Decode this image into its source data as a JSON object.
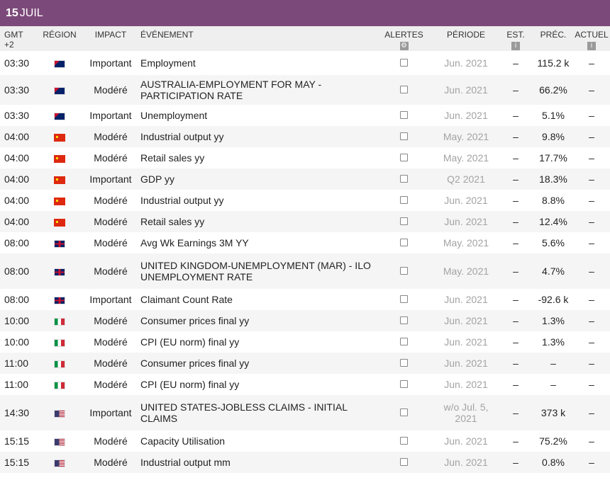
{
  "date": {
    "day": "15",
    "month": "JUIL"
  },
  "headers": {
    "gmt": "GMT +2",
    "region": "RÉGION",
    "impact": "IMPACT",
    "event": "ÉVÉNEMENT",
    "alerts": "ALERTES",
    "period": "PÉRIODE",
    "est": "EST.",
    "prec": "PRÉC.",
    "actuel": "ACTUEL"
  },
  "icons": {
    "gear": "gear-icon",
    "info": "info-icon"
  },
  "rows": [
    {
      "time": "03:30",
      "flag": "au",
      "impact": "Important",
      "event": "Employment",
      "period": "Jun. 2021",
      "est": "–",
      "prec": "115.2 k",
      "actuel": "–"
    },
    {
      "time": "03:30",
      "flag": "au",
      "impact": "Modéré",
      "event": "AUSTRALIA-EMPLOYMENT FOR MAY - PARTICIPATION RATE",
      "period": "Jun. 2021",
      "est": "–",
      "prec": "66.2%",
      "actuel": "–"
    },
    {
      "time": "03:30",
      "flag": "au",
      "impact": "Important",
      "event": "Unemployment",
      "period": "Jun. 2021",
      "est": "–",
      "prec": "5.1%",
      "actuel": "–"
    },
    {
      "time": "04:00",
      "flag": "cn",
      "impact": "Modéré",
      "event": "Industrial output yy",
      "period": "May. 2021",
      "est": "–",
      "prec": "9.8%",
      "actuel": "–"
    },
    {
      "time": "04:00",
      "flag": "cn",
      "impact": "Modéré",
      "event": "Retail sales yy",
      "period": "May. 2021",
      "est": "–",
      "prec": "17.7%",
      "actuel": "–"
    },
    {
      "time": "04:00",
      "flag": "cn",
      "impact": "Important",
      "event": "GDP yy",
      "period": "Q2 2021",
      "est": "–",
      "prec": "18.3%",
      "actuel": "–"
    },
    {
      "time": "04:00",
      "flag": "cn",
      "impact": "Modéré",
      "event": "Industrial output yy",
      "period": "Jun. 2021",
      "est": "–",
      "prec": "8.8%",
      "actuel": "–"
    },
    {
      "time": "04:00",
      "flag": "cn",
      "impact": "Modéré",
      "event": "Retail sales yy",
      "period": "Jun. 2021",
      "est": "–",
      "prec": "12.4%",
      "actuel": "–"
    },
    {
      "time": "08:00",
      "flag": "gb",
      "impact": "Modéré",
      "event": "Avg Wk Earnings 3M YY",
      "period": "May. 2021",
      "est": "–",
      "prec": "5.6%",
      "actuel": "–"
    },
    {
      "time": "08:00",
      "flag": "gb",
      "impact": "Modéré",
      "event": "UNITED KINGDOM-UNEMPLOYMENT (MAR) - ILO UNEMPLOYMENT RATE",
      "period": "May. 2021",
      "est": "–",
      "prec": "4.7%",
      "actuel": "–"
    },
    {
      "time": "08:00",
      "flag": "gb",
      "impact": "Important",
      "event": "Claimant Count Rate",
      "period": "Jun. 2021",
      "est": "–",
      "prec": "-92.6 k",
      "actuel": "–"
    },
    {
      "time": "10:00",
      "flag": "it",
      "impact": "Modéré",
      "event": "Consumer prices final yy",
      "period": "Jun. 2021",
      "est": "–",
      "prec": "1.3%",
      "actuel": "–"
    },
    {
      "time": "10:00",
      "flag": "it",
      "impact": "Modéré",
      "event": "CPI (EU norm) final yy",
      "period": "Jun. 2021",
      "est": "–",
      "prec": "1.3%",
      "actuel": "–"
    },
    {
      "time": "11:00",
      "flag": "it",
      "impact": "Modéré",
      "event": "Consumer prices final yy",
      "period": "Jun. 2021",
      "est": "–",
      "prec": "–",
      "actuel": "–"
    },
    {
      "time": "11:00",
      "flag": "it",
      "impact": "Modéré",
      "event": "CPI (EU norm) final yy",
      "period": "Jun. 2021",
      "est": "–",
      "prec": "–",
      "actuel": "–"
    },
    {
      "time": "14:30",
      "flag": "us",
      "impact": "Important",
      "event": "UNITED STATES-JOBLESS CLAIMS - INITIAL CLAIMS",
      "period": "w/o Jul. 5, 2021",
      "est": "–",
      "prec": "373 k",
      "actuel": "–"
    },
    {
      "time": "15:15",
      "flag": "us",
      "impact": "Modéré",
      "event": "Capacity Utilisation",
      "period": "Jun. 2021",
      "est": "–",
      "prec": "75.2%",
      "actuel": "–"
    },
    {
      "time": "15:15",
      "flag": "us",
      "impact": "Modéré",
      "event": "Industrial output mm",
      "period": "Jun. 2021",
      "est": "–",
      "prec": "0.8%",
      "actuel": "–"
    }
  ]
}
